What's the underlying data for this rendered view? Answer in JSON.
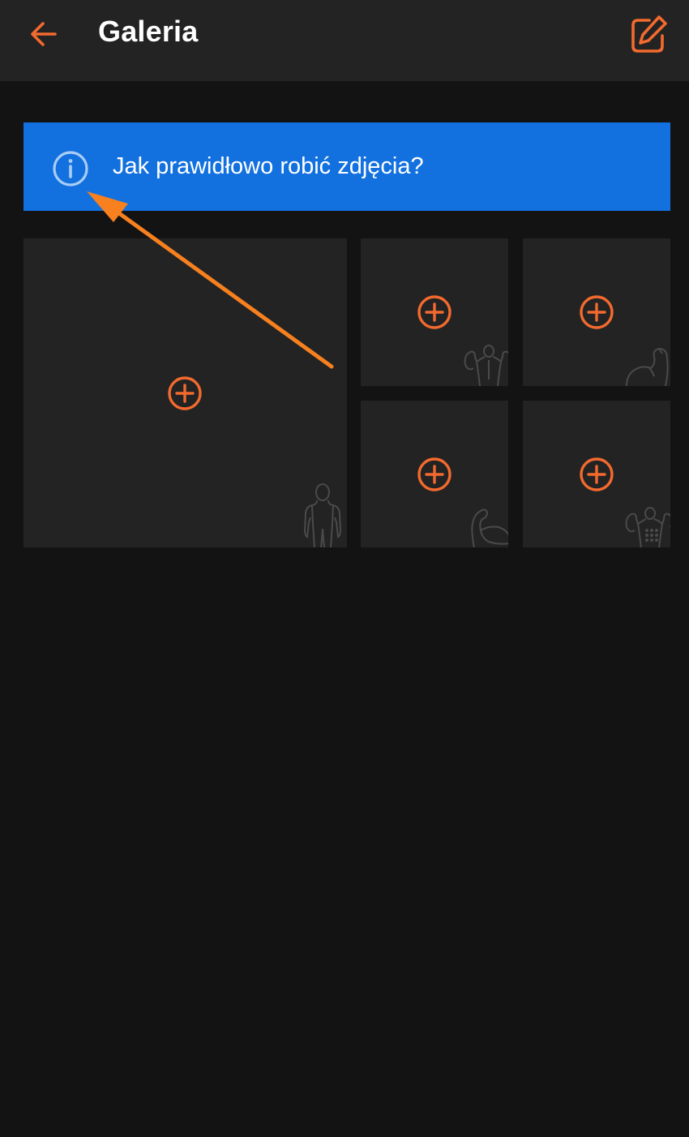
{
  "header": {
    "title": "Galeria",
    "back_icon": "arrow-left-icon",
    "edit_icon": "edit-icon"
  },
  "info_banner": {
    "text": "Jak prawidłowo robić zdjęcia?",
    "icon": "info-icon"
  },
  "photo_slots": [
    {
      "pose": "front",
      "icon": "front-silhouette-icon"
    },
    {
      "pose": "back",
      "icon": "back-silhouette-icon"
    },
    {
      "pose": "biceps",
      "icon": "biceps-silhouette-icon"
    },
    {
      "pose": "side",
      "icon": "side-biceps-silhouette-icon"
    },
    {
      "pose": "abs",
      "icon": "abs-silhouette-icon"
    }
  ],
  "colors": {
    "background": "#131313",
    "app_bar": "#232323",
    "tile": "#232323",
    "accent": "#f36a2e",
    "banner": "#1271de",
    "annotation_arrow": "#f7801f"
  }
}
